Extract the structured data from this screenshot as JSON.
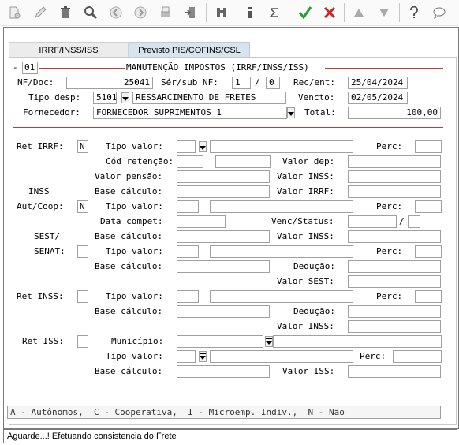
{
  "toolbar": {
    "icons": [
      "new-document-icon",
      "edit-icon",
      "trash-icon",
      "search-icon",
      "previous-icon",
      "next-icon",
      "print-icon",
      "export-icon",
      "binoculars-icon",
      "info-icon",
      "sigma-icon",
      "confirm-check-icon",
      "cancel-x-icon",
      "move-up-icon",
      "move-down-icon",
      "help-icon",
      "chat-icon"
    ]
  },
  "tabs": {
    "active": "IRRF/INSS/ISS",
    "inactive": "Previsto PIS/COFINS/CSL"
  },
  "section": {
    "number": "01",
    "title": "MANUTENÇÃO IMPOSTOS (IRRF/INSS/ISS)",
    "dash": "-"
  },
  "header": {
    "nfdoc_label": "NF/Doc:",
    "nfdoc_value": "25041",
    "sersub_label": "Sér/sub NF:",
    "ser_value": "1",
    "slash": "/",
    "sub_value": "0",
    "recent_label": "Rec/ent:",
    "recent_value": "25/04/2024",
    "tipodesp_label": "Tipo desp:",
    "tipodesp_code": "5101",
    "tipodesp_desc": "RESSARCIMENTO DE FRETES",
    "vencto_label": "Vencto:",
    "vencto_value": "02/05/2024",
    "fornecedor_label": "Fornecedor:",
    "fornecedor_value": "FORNECEDOR SUPRIMENTOS 1",
    "total_label": "Total:",
    "total_value": "100,00"
  },
  "irrf": {
    "ret_label": "Ret IRRF:",
    "ret_value": "N",
    "tipo_valor_label": "Tipo valor:",
    "perc_label": "Perc:",
    "cod_retencao_label": "Cód retenção:",
    "valor_dep_label": "Valor dep:",
    "valor_pensao_label": "Valor pensão:",
    "valor_inss_label": "Valor INSS:",
    "base_calculo_label": "Base cálculo:",
    "valor_irrf_label": "Valor IRRF:"
  },
  "inss": {
    "inss_label": "INSS",
    "autcoop_label": "Aut/Coop:",
    "autcoop_value": "N",
    "tipo_valor_label": "Tipo valor:",
    "perc_label": "Perc:",
    "data_compet_label": "Data compet:",
    "venc_status_label": "Venc/Status:",
    "slash": "/",
    "base_calculo_label": "Base cálculo:",
    "valor_inss_label": "Valor INSS:"
  },
  "sest": {
    "sest_label": "SEST/",
    "senat_label": "SENAT:",
    "tipo_valor_label": "Tipo valor:",
    "perc_label": "Perc:",
    "base_calculo_label": "Base cálculo:",
    "deducao_label": "Dedução:",
    "valor_sest_label": "Valor SEST:"
  },
  "retinss": {
    "ret_label": "Ret INSS:",
    "tipo_valor_label": "Tipo valor:",
    "perc_label": "Perc:",
    "base_calculo_label": "Base cálculo:",
    "deducao_label": "Dedução:",
    "valor_inss_label": "Valor INSS:"
  },
  "iss": {
    "ret_label": "Ret ISS:",
    "municipio_label": "Município:",
    "tipo_valor_label": "Tipo valor:",
    "perc_label": "Perc:",
    "base_calculo_label": "Base cálculo:",
    "valor_iss_label": "Valor ISS:"
  },
  "hint": "A - Autônomos,  C - Cooperativa,  I - Microemp. Indiv.,  N - Não",
  "status": "Aguarde...! Efetuando consistencia do Frete",
  "colors": {
    "accent_red": "#c23b3b",
    "check_green": "#2a9a3a",
    "tab_blue": "#d7e4ee"
  }
}
